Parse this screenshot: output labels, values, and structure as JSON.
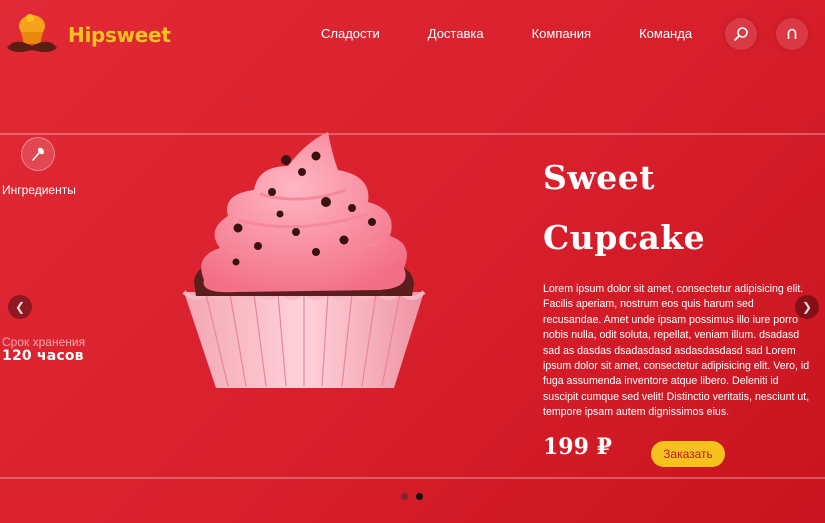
{
  "brand": {
    "name": "Hipsweet"
  },
  "nav": {
    "items": [
      {
        "label": "Сладости"
      },
      {
        "label": "Доставка"
      },
      {
        "label": "Компания"
      },
      {
        "label": "Команда"
      }
    ]
  },
  "header": {
    "search_icon": "search-icon",
    "user_icon": "user-icon"
  },
  "slide": {
    "ingredients_label": "Ингредиенты",
    "shelf_life_label": "Срок хранения",
    "shelf_life_value": "120 часов",
    "title_line1": "Sweet",
    "title_line2": "Cupcake",
    "description": "Lorem ipsum dolor sit amet, consectetur adipisicing elit. Facilis aperiam, nostrum eos quis harum sed recusandae. Amet unde ipsam possimus illo iure porro nobis nulla, odit soluta, repellat, veniam illum. dsadasd sad as dasdas dsadasdasd asdasdasdasd sad Lorem ipsum dolor sit amet, consectetur adipisicing elit. Vero, id fuga assumenda inventore atque libero. Deleniti id suscipit cumque sed velit! Distinctio veritatis, nesciunt ut, tempore ipsam autem dignissimos eius.",
    "price": "199 ₽",
    "order_label": "Заказать"
  },
  "slider": {
    "total_slides": 2,
    "active_slide": 2
  },
  "colors": {
    "background": "#d81f2c",
    "accent_yellow": "#f7c21d",
    "frosting_pink": "#f78c9c"
  }
}
